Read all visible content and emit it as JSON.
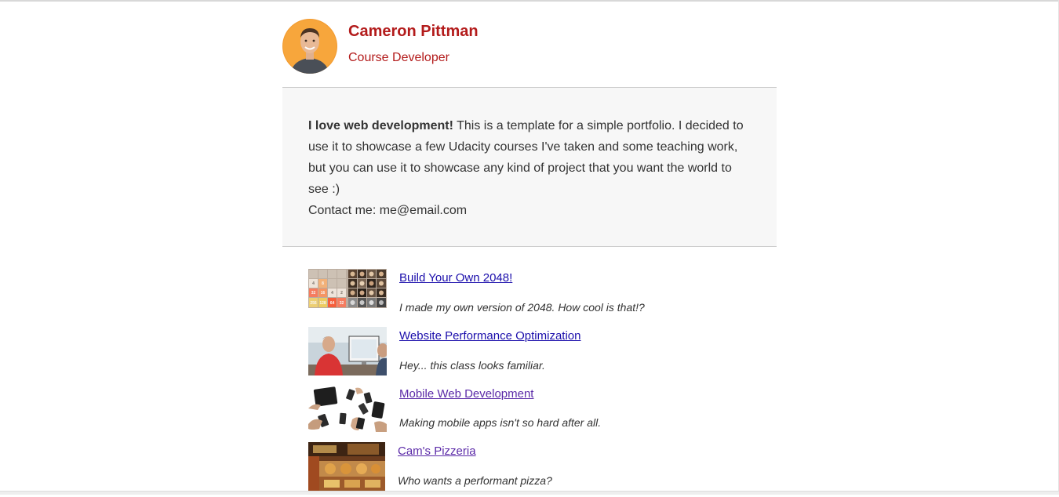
{
  "profile": {
    "name": "Cameron Pittman",
    "role": "Course Developer"
  },
  "about": {
    "bold_intro": "I love web development!",
    "body": " This is a template for a simple portfolio. I decided to use it to showcase a few Udacity courses I've taken and some teaching work, but you can use it to showcase any kind of project that you want the world to see :)",
    "contact": "Contact me: me@email.com"
  },
  "projects": [
    {
      "title": "Build Your Own 2048!",
      "description": "I made my own version of 2048. How cool is that!?",
      "thumb_cells": [
        "",
        "",
        "",
        "",
        "4",
        "8",
        "",
        "",
        "32",
        "16",
        "4",
        "2",
        "256",
        "128",
        "64",
        "32"
      ]
    },
    {
      "title": "Website Performance Optimization",
      "description": "Hey... this class looks familiar."
    },
    {
      "title": "Mobile Web Development",
      "description": "Making mobile apps isn't so hard after all."
    },
    {
      "title": "Cam's Pizzeria",
      "description": "Who wants a performant pizza?"
    }
  ],
  "colors": {
    "accent": "#b31b1b",
    "link": "#1a0dab",
    "visited_link": "#5b2aa8",
    "about_bg": "#f7f7f7"
  }
}
